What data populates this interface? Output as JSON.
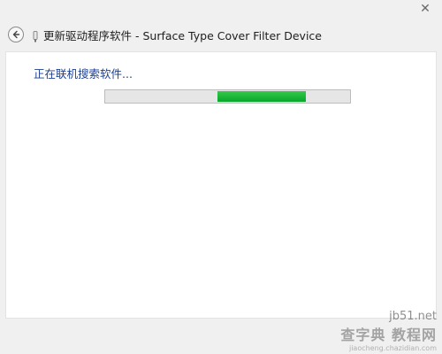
{
  "window": {
    "close_glyph": "✕",
    "title": "更新驱动程序软件 - Surface Type Cover Filter Device"
  },
  "content": {
    "status_text": "正在联机搜索软件...",
    "progress": {
      "mode": "indeterminate",
      "segment_start_fraction": 0.46,
      "segment_end_fraction": 0.82,
      "color": "#0aab2e"
    }
  },
  "watermark": {
    "line1": "jb51.net",
    "line2": "查字典 教程网",
    "line3": "jiaocheng.chazidian.com"
  },
  "icons": {
    "back": "back-arrow-icon",
    "device": "device-icon",
    "close": "close-icon"
  }
}
